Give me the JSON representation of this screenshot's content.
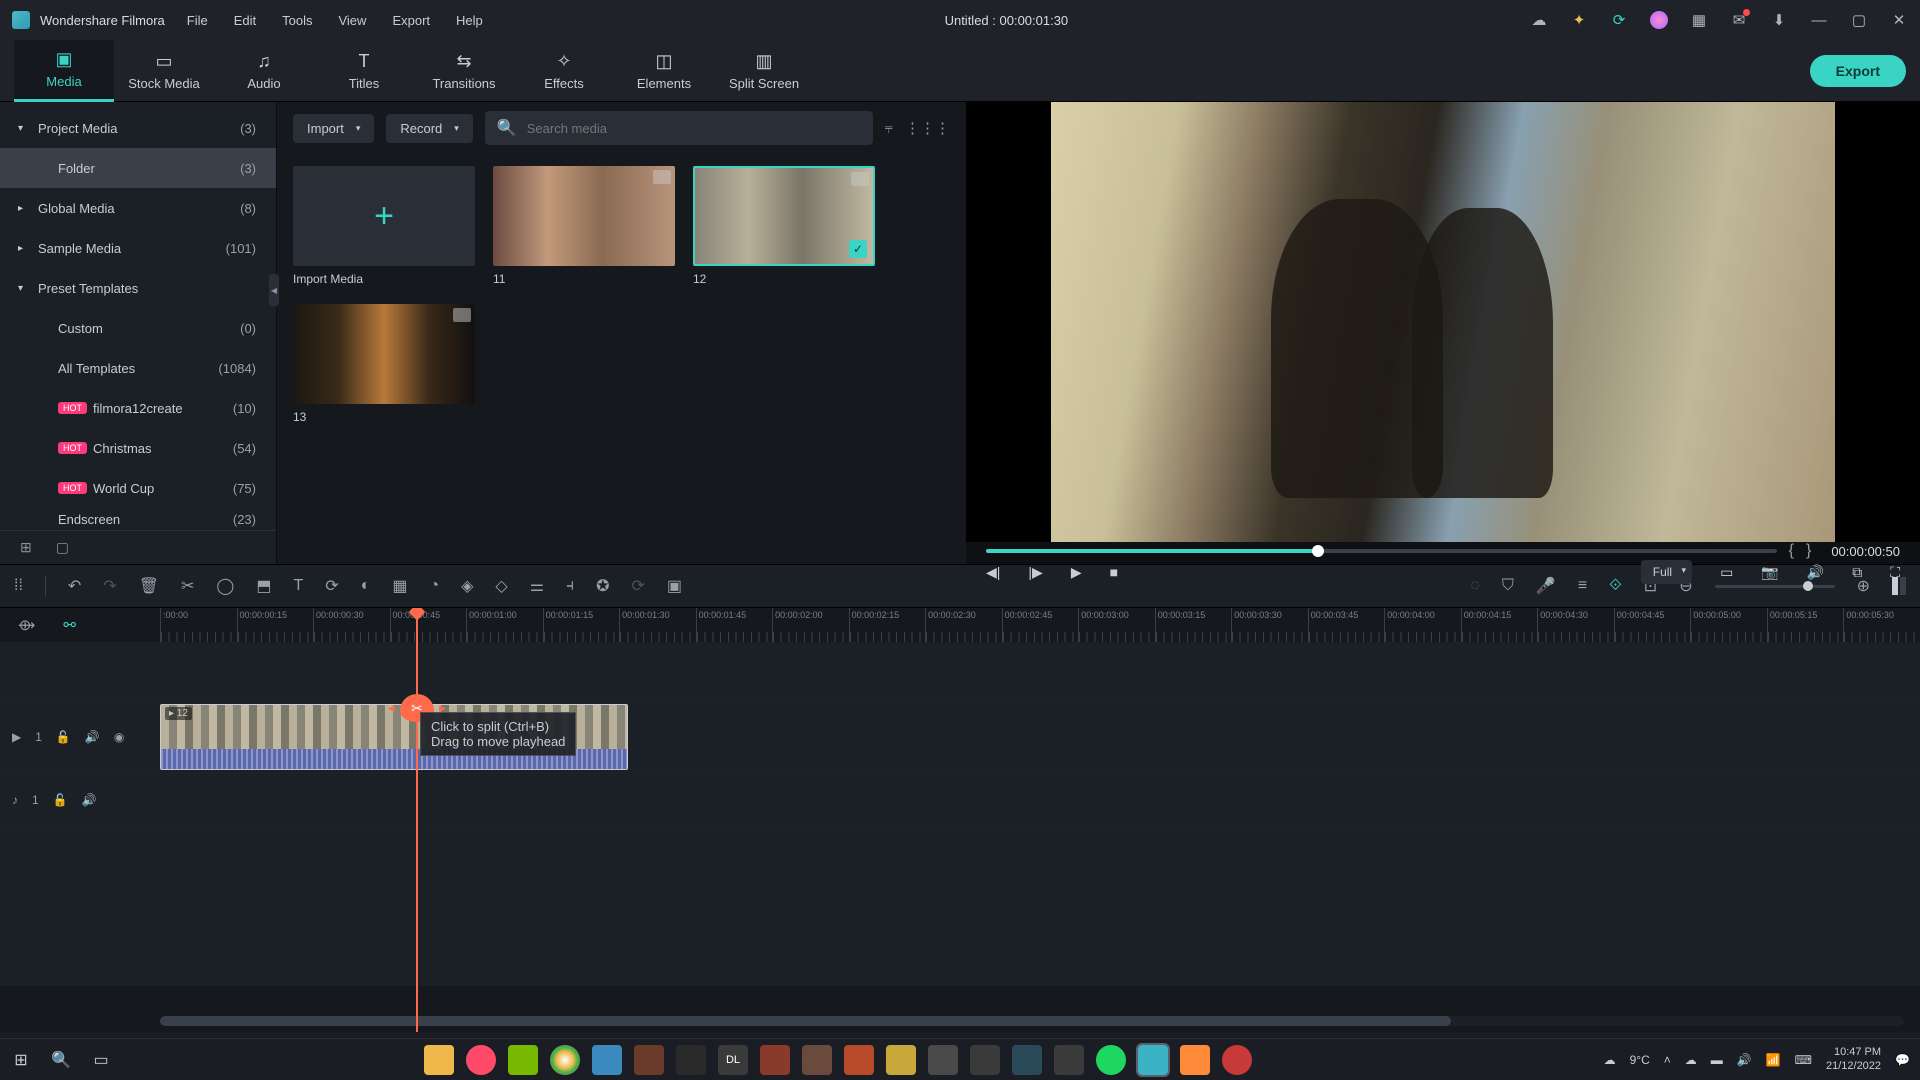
{
  "app": {
    "name": "Wondershare Filmora",
    "title": "Untitled : 00:00:01:30"
  },
  "menu": [
    "File",
    "Edit",
    "Tools",
    "View",
    "Export",
    "Help"
  ],
  "tabs": [
    {
      "label": "Media",
      "active": true
    },
    {
      "label": "Stock Media"
    },
    {
      "label": "Audio"
    },
    {
      "label": "Titles"
    },
    {
      "label": "Transitions"
    },
    {
      "label": "Effects"
    },
    {
      "label": "Elements"
    },
    {
      "label": "Split Screen"
    }
  ],
  "export_label": "Export",
  "sidebar": [
    {
      "label": "Project Media",
      "count": "(3)",
      "cls": "exp"
    },
    {
      "label": "Folder",
      "count": "(3)",
      "cls": "sub",
      "selected": true
    },
    {
      "label": "Global Media",
      "count": "(8)",
      "cls": "col"
    },
    {
      "label": "Sample Media",
      "count": "(101)",
      "cls": "col"
    },
    {
      "label": "Preset Templates",
      "count": "",
      "cls": "exp"
    },
    {
      "label": "Custom",
      "count": "(0)",
      "cls": "sub"
    },
    {
      "label": "All Templates",
      "count": "(1084)",
      "cls": "sub"
    },
    {
      "label": "filmora12create",
      "count": "(10)",
      "cls": "sub",
      "hot": true
    },
    {
      "label": "Christmas",
      "count": "(54)",
      "cls": "sub",
      "hot": true
    },
    {
      "label": "World Cup",
      "count": "(75)",
      "cls": "sub",
      "hot": true
    },
    {
      "label": "Endscreen",
      "count": "(23)",
      "cls": "sub",
      "cut": true
    }
  ],
  "media_toolbar": {
    "import": "Import",
    "record": "Record",
    "search_placeholder": "Search media"
  },
  "media_items": {
    "import": "Import Media",
    "m11": "11",
    "m12": "12",
    "m13": "13"
  },
  "preview": {
    "timecode": "00:00:00:50",
    "quality": "Full"
  },
  "ruler_ticks": [
    ":00:00",
    "00:00:00:15",
    "00:00:00:30",
    "00:00:00:45",
    "00:00:01:00",
    "00:00:01:15",
    "00:00:01:30",
    "00:00:01:45",
    "00:00:02:00",
    "00:00:02:15",
    "00:00:02:30",
    "00:00:02:45",
    "00:00:03:00",
    "00:00:03:15",
    "00:00:03:30",
    "00:00:03:45",
    "00:00:04:00",
    "00:00:04:15",
    "00:00:04:30",
    "00:00:04:45",
    "00:00:05:00",
    "00:00:05:15",
    "00:00:05:30"
  ],
  "tooltip": {
    "l1": "Click to split (Ctrl+B)",
    "l2": "Drag to move playhead"
  },
  "track_labels": {
    "v": "1",
    "a": "1"
  },
  "taskbar": {
    "weather": "9°C",
    "time": "10:47 PM",
    "date": "21/12/2022"
  }
}
